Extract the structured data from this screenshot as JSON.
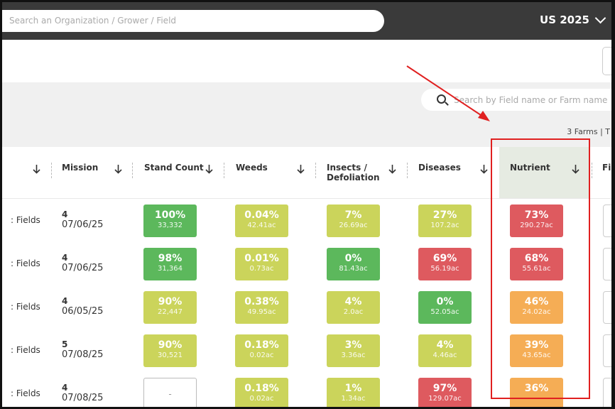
{
  "topbar": {
    "search_placeholder": "Search an Organization / Grower / Field",
    "region_label": "US 2025"
  },
  "toolbar": {
    "field_search_placeholder": "Search by Field name or Farm name",
    "farm_count": "3 Farms | T"
  },
  "columns": {
    "mission": "Mission",
    "stand_count": "Stand Count",
    "weeds": "Weeds",
    "insects_line1": "Insects /",
    "insects_line2": "Defoliation",
    "diseases": "Diseases",
    "nutrient": "Nutrient",
    "next_truncated": "Fi"
  },
  "colors": {
    "green": "#5cb85c",
    "yellow_green": "#cbd45b",
    "red": "#de5a5f",
    "orange": "#f5ad55",
    "highlight": "#e02020"
  },
  "rows": [
    {
      "fields": ": Fields",
      "mission_num": "4",
      "mission_date": "07/06/25",
      "stand": {
        "pct": "100%",
        "sub": "33,332",
        "color": "#5cb85c"
      },
      "weeds": {
        "pct": "0.04%",
        "sub": "42.41ac",
        "color": "#cbd45b"
      },
      "insects": {
        "pct": "7%",
        "sub": "26.69ac",
        "color": "#cbd45b"
      },
      "diseases": {
        "pct": "27%",
        "sub": "107.2ac",
        "color": "#cbd45b"
      },
      "nutrient": {
        "pct": "73%",
        "sub": "290.27ac",
        "color": "#de5a5f"
      }
    },
    {
      "fields": ": Fields",
      "mission_num": "4",
      "mission_date": "07/06/25",
      "stand": {
        "pct": "98%",
        "sub": "31,364",
        "color": "#5cb85c"
      },
      "weeds": {
        "pct": "0.01%",
        "sub": "0.73ac",
        "color": "#cbd45b"
      },
      "insects": {
        "pct": "0%",
        "sub": "81.43ac",
        "color": "#5cb85c"
      },
      "diseases": {
        "pct": "69%",
        "sub": "56.19ac",
        "color": "#de5a5f"
      },
      "nutrient": {
        "pct": "68%",
        "sub": "55.61ac",
        "color": "#de5a5f"
      }
    },
    {
      "fields": ": Fields",
      "mission_num": "4",
      "mission_date": "06/05/25",
      "stand": {
        "pct": "90%",
        "sub": "22,447",
        "color": "#cbd45b"
      },
      "weeds": {
        "pct": "0.38%",
        "sub": "49.95ac",
        "color": "#cbd45b"
      },
      "insects": {
        "pct": "4%",
        "sub": "2.0ac",
        "color": "#cbd45b"
      },
      "diseases": {
        "pct": "0%",
        "sub": "52.05ac",
        "color": "#5cb85c"
      },
      "nutrient": {
        "pct": "46%",
        "sub": "24.02ac",
        "color": "#f5ad55"
      }
    },
    {
      "fields": ": Fields",
      "mission_num": "5",
      "mission_date": "07/08/25",
      "stand": {
        "pct": "90%",
        "sub": "30,521",
        "color": "#cbd45b"
      },
      "weeds": {
        "pct": "0.18%",
        "sub": "0.02ac",
        "color": "#cbd45b"
      },
      "insects": {
        "pct": "3%",
        "sub": "3.36ac",
        "color": "#cbd45b"
      },
      "diseases": {
        "pct": "4%",
        "sub": "4.46ac",
        "color": "#cbd45b"
      },
      "nutrient": {
        "pct": "39%",
        "sub": "43.65ac",
        "color": "#f5ad55"
      }
    },
    {
      "fields": ": Fields",
      "mission_num": "4",
      "mission_date": "07/08/25",
      "stand": {
        "pct": "-",
        "sub": "",
        "color": "empty"
      },
      "weeds": {
        "pct": "0.18%",
        "sub": "0.02ac",
        "color": "#cbd45b"
      },
      "insects": {
        "pct": "1%",
        "sub": "1.34ac",
        "color": "#cbd45b"
      },
      "diseases": {
        "pct": "97%",
        "sub": "129.07ac",
        "color": "#de5a5f"
      },
      "nutrient": {
        "pct": "36%",
        "sub": "",
        "color": "#f5ad55"
      }
    }
  ]
}
